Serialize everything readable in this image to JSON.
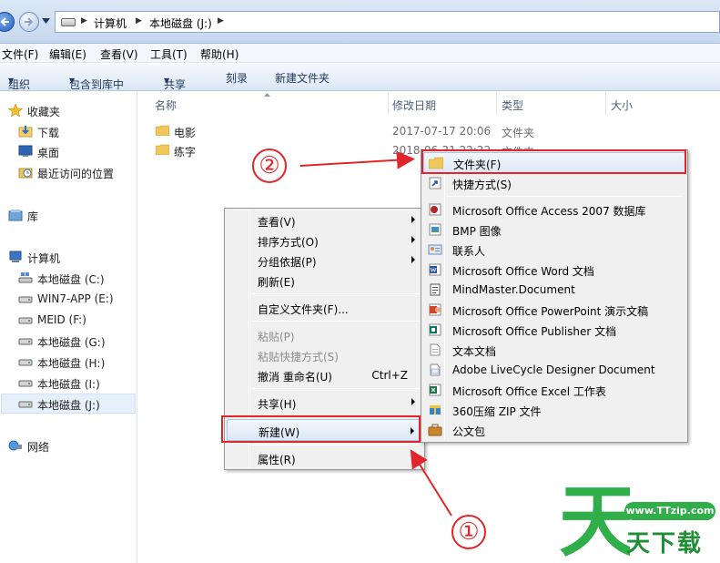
{
  "address": {
    "crumbs": [
      "计算机",
      "本地磁盘 (J:)"
    ]
  },
  "menubar": [
    "文件(F)",
    "编辑(E)",
    "查看(V)",
    "工具(T)",
    "帮助(H)"
  ],
  "toolbar": [
    "组织",
    "包含到库中",
    "共享",
    "刻录",
    "新建文件夹"
  ],
  "nav": {
    "favorites": "收藏夹",
    "downloads": "下载",
    "desktop": "桌面",
    "recent": "最近访问的位置",
    "library": "库",
    "computer": "计算机",
    "drives": [
      "本地磁盘 (C:)",
      "WIN7-APP (E:)",
      "MEID (F:)",
      "本地磁盘 (G:)",
      "本地磁盘 (H:)",
      "本地磁盘 (I:)",
      "本地磁盘 (J:)"
    ],
    "network": "网络"
  },
  "columns": [
    "名称",
    "修改日期",
    "类型",
    "大小"
  ],
  "files": [
    {
      "name": "电影",
      "date": "2017-07-17 20:06",
      "type": "文件夹"
    },
    {
      "name": "练字",
      "date": "2018-06-21 22:22",
      "type": "文件夹"
    }
  ],
  "context_menu": {
    "view": "查看(V)",
    "sort": "排序方式(O)",
    "group": "分组依据(P)",
    "refresh": "刷新(E)",
    "customize": "自定义文件夹(F)...",
    "paste": "粘贴(P)",
    "paste_shortcut": "粘贴快捷方式(S)",
    "undo": "撤消 重命名(U)",
    "undo_shortcut": "Ctrl+Z",
    "share": "共享(H)",
    "new": "新建(W)",
    "properties": "属性(R)"
  },
  "new_submenu": [
    "文件夹(F)",
    "快捷方式(S)",
    "Microsoft Office Access 2007 数据库",
    "BMP 图像",
    "联系人",
    "Microsoft Office Word 文档",
    "MindMaster.Document",
    "Microsoft Office PowerPoint 演示文稿",
    "Microsoft Office Publisher 文档",
    "文本文档",
    "Adobe LiveCycle Designer Document",
    "Microsoft Office Excel 工作表",
    "360压缩 ZIP 文件",
    "公文包"
  ],
  "callouts": {
    "one": "①",
    "two": "②"
  },
  "watermark": {
    "url": "www.TTzip.com",
    "name": "天下载",
    "logo_char": "天"
  },
  "colors": {
    "highlight": "#e0262a",
    "watermark_green": "#2fae49"
  }
}
